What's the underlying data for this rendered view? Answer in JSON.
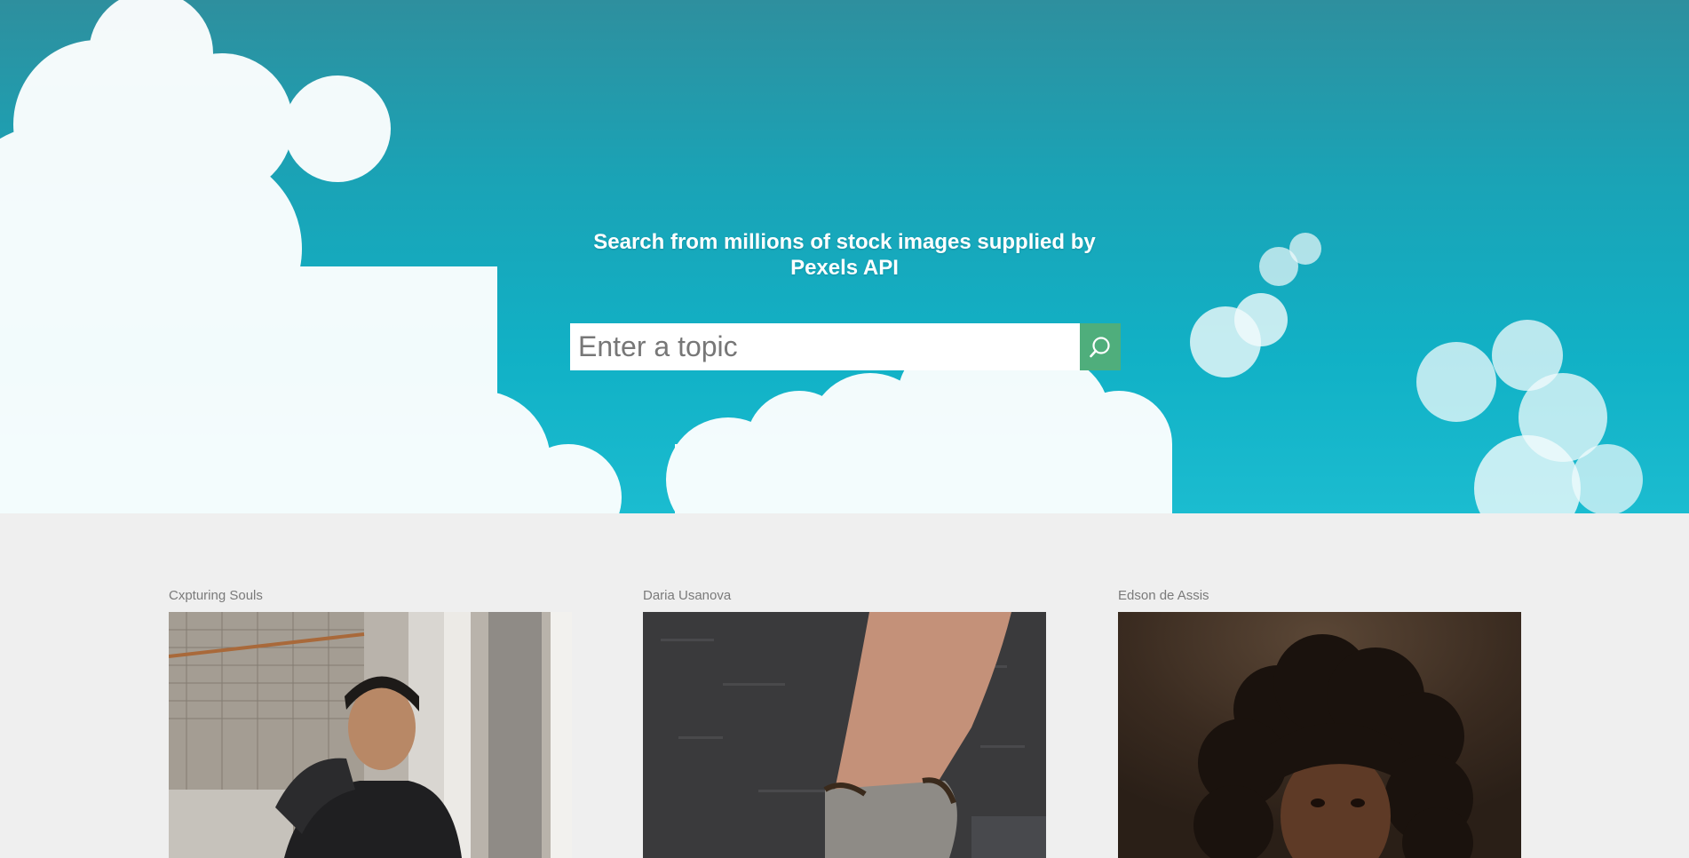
{
  "hero": {
    "title": "Search from millions of stock images supplied by Pexels API",
    "search": {
      "placeholder": "Enter a topic",
      "value": "",
      "button_icon": "search-icon"
    }
  },
  "photos": [
    {
      "author": "Cxpturing Souls"
    },
    {
      "author": "Daria Usanova"
    },
    {
      "author": "Edson de Assis"
    }
  ],
  "colors": {
    "sky": "#11b1c6",
    "search_button": "#4fae7c",
    "page_background": "#efefef",
    "author_text": "#7a7a7a"
  }
}
